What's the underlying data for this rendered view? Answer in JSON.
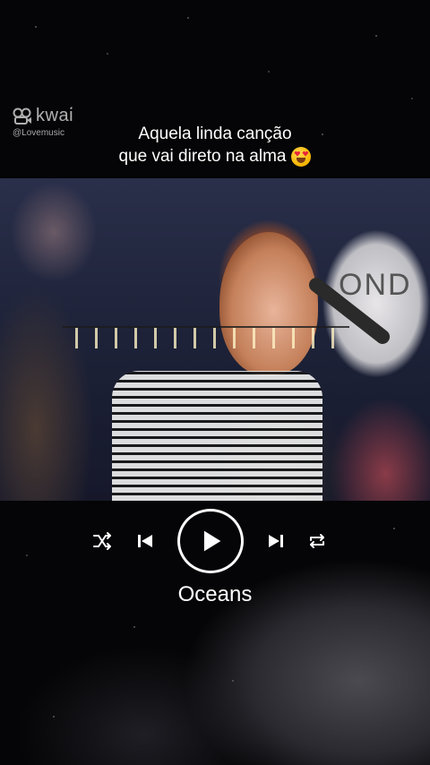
{
  "watermark": {
    "brand": "kwai",
    "handle": "@Lovemusic"
  },
  "caption": {
    "line1": "Aquela linda canção",
    "line2": "que vai direto na alma",
    "emoji": "heart-eyes-emoji"
  },
  "video": {
    "sign_text": "OND"
  },
  "player": {
    "controls": [
      "shuffle-icon",
      "previous-icon",
      "play-icon",
      "next-icon",
      "repeat-icon"
    ],
    "song_title": "Oceans"
  },
  "colors": {
    "background": "#050507",
    "text": "#ffffff"
  }
}
